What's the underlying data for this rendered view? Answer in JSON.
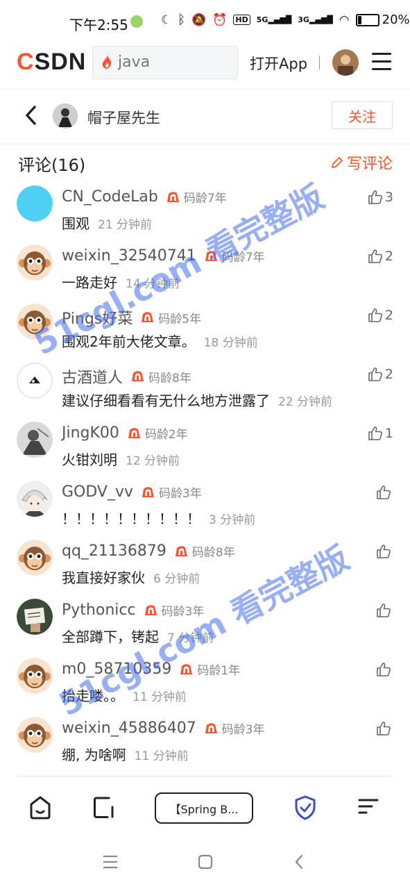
{
  "status_bar": {
    "time": "下午2:55",
    "network_5g": "5G",
    "network_3g": "3G",
    "battery": "20%",
    "battery_level": 0.2
  },
  "header": {
    "logo": "CSDN",
    "search_query": "java",
    "open_app_label": "打开App"
  },
  "author": {
    "name": "帽子屋先生",
    "follow_label": "关注"
  },
  "comments_section": {
    "title": "评论(16)",
    "write_label": "写评论"
  },
  "comments": [
    {
      "user": "CN_CodeLab",
      "badge": "码龄7年",
      "text": "围观",
      "time": "21 分钟前",
      "likes": "3",
      "avatar": "blue-circle"
    },
    {
      "user": "weixin_32540741",
      "badge": "码龄7年",
      "text": "一路走好",
      "time": "14 分钟前",
      "likes": "2",
      "avatar": "monkey"
    },
    {
      "user": "Pings好菜",
      "badge": "码龄5年",
      "text": "围观2年前大佬文章。",
      "time": "18 分钟前",
      "likes": "2",
      "avatar": "monkey"
    },
    {
      "user": "古酒道人",
      "badge": "码龄8年",
      "text": "建议仔细看看有无什么地方泄露了",
      "time": "22 分钟前",
      "likes": "2",
      "avatar": "ink"
    },
    {
      "user": "JingK00",
      "badge": "码龄2年",
      "text": "火钳刘明",
      "time": "12 分钟前",
      "likes": "1",
      "avatar": "gray"
    },
    {
      "user": "GODV_vv",
      "badge": "码龄3年",
      "text": "！！！！！！！！！！",
      "time": "3 分钟前",
      "likes": "",
      "avatar": "anime"
    },
    {
      "user": "qq_21136879",
      "badge": "码龄8年",
      "text": "我直接好家伙",
      "time": "6 分钟前",
      "likes": "",
      "avatar": "monkey"
    },
    {
      "user": "Pythonicc",
      "badge": "码龄3年",
      "text": "全部蹲下，铐起",
      "time": "7 分钟前",
      "likes": "",
      "avatar": "python"
    },
    {
      "user": "m0_58710359",
      "badge": "码龄1年",
      "text": "抬走喽。。",
      "time": "11 分钟前",
      "likes": "",
      "avatar": "monkey"
    },
    {
      "user": "weixin_45886407",
      "badge": "码龄3年",
      "text": "绷, 为啥啊",
      "time": "11 分钟前",
      "likes": "",
      "avatar": "monkey"
    }
  ],
  "bottom_bar": {
    "article_label": "【Spring B..."
  },
  "watermark": "51cgl.com 看完整版",
  "colors": {
    "accent": "#fc5531",
    "watermark": "#466eeb"
  }
}
